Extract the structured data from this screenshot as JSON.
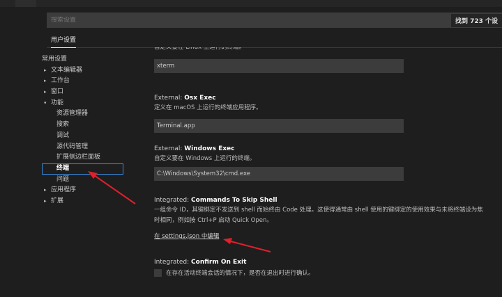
{
  "search": {
    "placeholder": "搜索设置",
    "result_count": "找到 723 个设"
  },
  "tabs": {
    "user_settings": "用户设置"
  },
  "toc": {
    "items": [
      {
        "label": "常用设置",
        "level": 0,
        "chevron": ""
      },
      {
        "label": "文本编辑器",
        "level": 1,
        "chevron": "▸"
      },
      {
        "label": "工作台",
        "level": 1,
        "chevron": "▸"
      },
      {
        "label": "窗口",
        "level": 1,
        "chevron": "▸"
      },
      {
        "label": "功能",
        "level": 1,
        "chevron": "▾"
      },
      {
        "label": "资源管理器",
        "level": 2,
        "chevron": ""
      },
      {
        "label": "搜索",
        "level": 2,
        "chevron": ""
      },
      {
        "label": "调试",
        "level": 2,
        "chevron": ""
      },
      {
        "label": "源代码管理",
        "level": 2,
        "chevron": ""
      },
      {
        "label": "扩展侧边栏面板",
        "level": 2,
        "chevron": ""
      },
      {
        "label": "终端",
        "level": 2,
        "chevron": "",
        "selected": true
      },
      {
        "label": "问题",
        "level": 2,
        "chevron": ""
      },
      {
        "label": "应用程序",
        "level": 1,
        "chevron": "▸"
      },
      {
        "label": "扩展",
        "level": 1,
        "chevron": "▸"
      }
    ]
  },
  "settings": {
    "linux_exec": {
      "description": "自定义要在 Linux 上运行的终端。",
      "value": "xterm"
    },
    "osx_exec": {
      "category": "External: ",
      "name": "Osx Exec",
      "description": "定义在 macOS 上运行的终端应用程序。",
      "value": "Terminal.app"
    },
    "windows_exec": {
      "category": "External: ",
      "name": "Windows Exec",
      "description": "自定义要在 Windows 上运行的终端。",
      "value": "C:\\Windows\\System32\\cmd.exe"
    },
    "commands_to_skip_shell": {
      "category": "Integrated: ",
      "name": "Commands To Skip Shell",
      "description_line1": "一组命令 ID，其键绑定不发送到 shell 而始终由 Code 处理。这使得通常由 shell 使用的键绑定的使用效果与未将终端设为焦",
      "description_line2": "时相同，例如按 Ctrl+P 启动 Quick Open。",
      "edit_link": "在 settings.json 中编辑"
    },
    "confirm_on_exit": {
      "category": "Integrated: ",
      "name": "Confirm On Exit",
      "checkbox_label": "在存在活动终端会话的情况下，是否在退出时进行确认。",
      "checked": false
    }
  },
  "colors": {
    "background": "#1e1e1e",
    "input_background": "#3c3c3c",
    "selection_outline": "#3a8ee6",
    "annotation_arrow": "#e0202c"
  }
}
